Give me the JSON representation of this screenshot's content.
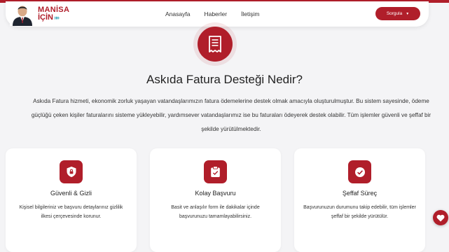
{
  "brand": {
    "line1": "MANİSA",
    "line2": "İÇİN",
    "chevrons": "»»",
    "accent_color": "#b01e2a",
    "chevron_color": "#3aa6b9"
  },
  "nav": {
    "links": [
      "Anasayfa",
      "Haberler",
      "İletişim"
    ],
    "sorgula_label": "Sorgula",
    "sorgula_caret": "▼"
  },
  "hero": {
    "icon": "receipt-icon",
    "title": "Askıda Fatura Desteği Nedir?",
    "description": "Askıda Fatura hizmeti, ekonomik zorluk yaşayan vatandaşlarımızın fatura ödemelerine destek olmak amacıyla oluşturulmuştur. Bu sistem sayesinde, ödeme güçlüğü çeken kişiler faturalarını sisteme yükleyebilir, yardımsever vatandaşlarımız ise bu faturaları ödeyerek destek olabilir. Tüm işlemler güvenli ve şeffaf bir şekilde yürütülmektedir."
  },
  "cards": [
    {
      "icon": "shield-lock-icon",
      "title": "Güvenli & Gizli",
      "text": "Kişisel bilgileriniz ve başvuru detaylarınız gizlilik ilkesi çerçevesinde korunur."
    },
    {
      "icon": "clipboard-icon",
      "title": "Kolay Başvuru",
      "text": "Basit ve anlaşılır form ile dakikalar içinde başvurunuzu tamamlayabilirsiniz."
    },
    {
      "icon": "check-circle-icon",
      "title": "Şeffaf Süreç",
      "text": "Başvurunuzun durumunu takip edebilir, tüm işlemler şeffaf bir şekilde yürütülür."
    }
  ],
  "floating": {
    "icon": "heart-icon"
  }
}
